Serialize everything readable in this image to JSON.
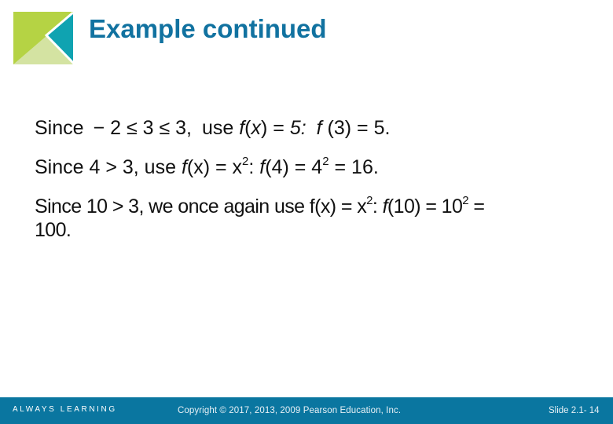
{
  "slide": {
    "title": "Example continued",
    "logo_icon": "pearson-corner-logo",
    "colors": {
      "title": "#1172a0",
      "footer_background": "#0a76a0",
      "logo_lime": "#b5d344",
      "logo_teal": "#0fa3b1",
      "logo_pale": "#d4e3a2"
    },
    "body": {
      "line1": {
        "since": "Since",
        "minus": "−",
        "inequality": "2 ≤ 3 ≤ 3,",
        "use": "use",
        "f": "f",
        "open_paren": "(",
        "x": "x",
        "equals_5": ") = ",
        "five_colon": "5:",
        "f2": "f",
        "result": " (3) = 5."
      },
      "line2": {
        "prefix": "Since 4 > 3, use ",
        "f": "f",
        "mid": "(x) = x",
        "sup1": "2",
        "colon": ": ",
        "f2": "f",
        "mid2": "(4) = 4",
        "sup2": "2",
        "result": " = 16."
      },
      "line3": {
        "prefix": "Since 10 > 3, we once again use f(x) = x",
        "sup1": "2",
        "colon": ": ",
        "f": "f",
        "mid": "(10) = 10",
        "sup2": "2",
        "equals": " =",
        "result": "100."
      }
    },
    "footer": {
      "brand": "ALWAYS LEARNING",
      "copyright": "Copyright © 2017, 2013, 2009 Pearson Education, Inc.",
      "slide_number": "Slide 2.1- 14"
    }
  }
}
